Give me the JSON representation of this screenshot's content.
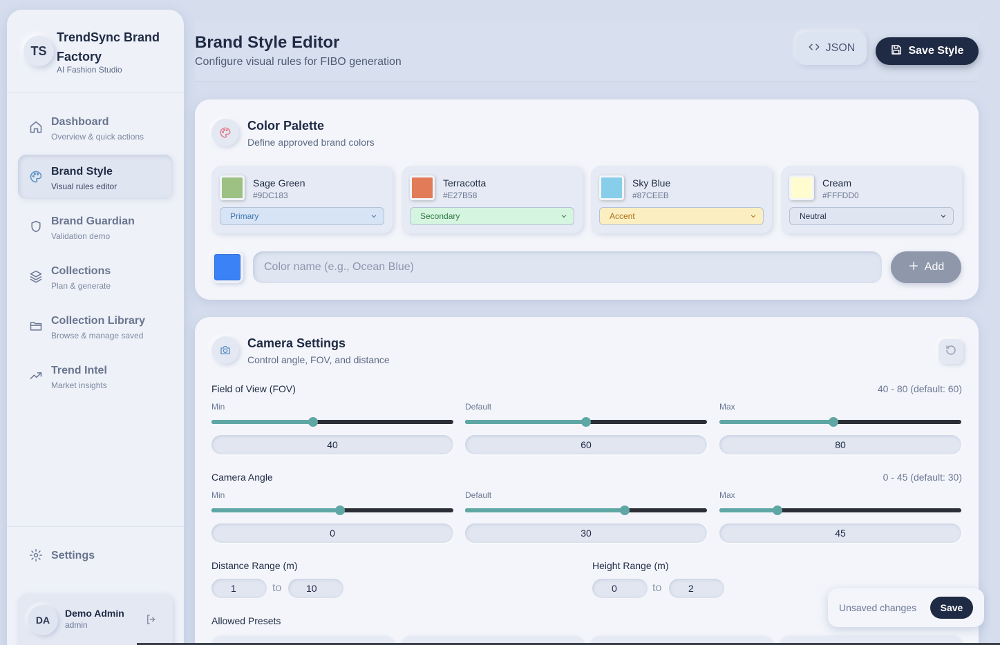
{
  "brand": {
    "initials": "TS",
    "title": "TrendSync Brand Factory",
    "subtitle": "AI Fashion Studio"
  },
  "nav": [
    {
      "label": "Dashboard",
      "sub": "Overview & quick actions",
      "icon": "home-icon",
      "active": false
    },
    {
      "label": "Brand Style",
      "sub": "Visual rules editor",
      "icon": "palette-icon",
      "active": true
    },
    {
      "label": "Brand Guardian",
      "sub": "Validation demo",
      "icon": "shield-icon",
      "active": false
    },
    {
      "label": "Collections",
      "sub": "Plan & generate",
      "icon": "layers-icon",
      "active": false
    },
    {
      "label": "Collection Library",
      "sub": "Browse & manage saved",
      "icon": "folder-icon",
      "active": false
    },
    {
      "label": "Trend Intel",
      "sub": "Market insights",
      "icon": "trending-icon",
      "active": false
    }
  ],
  "settings": {
    "label": "Settings",
    "icon": "gear-icon"
  },
  "user": {
    "initials": "DA",
    "name": "Demo Admin",
    "role": "admin"
  },
  "header": {
    "title": "Brand Style Editor",
    "subtitle": "Configure visual rules for FIBO generation",
    "json_label": "JSON",
    "save_label": "Save Style"
  },
  "palette": {
    "title": "Color Palette",
    "subtitle": "Define approved brand colors",
    "colors": [
      {
        "name": "Sage Green",
        "hex": "#9DC183",
        "role": "Primary",
        "role_bg": "#d6e4f5",
        "role_color": "#3f76b0"
      },
      {
        "name": "Terracotta",
        "hex": "#E27B58",
        "role": "Secondary",
        "role_bg": "#d6f5e0",
        "role_color": "#2f7a45"
      },
      {
        "name": "Sky Blue",
        "hex": "#87CEEB",
        "role": "Accent",
        "role_bg": "#fbefc2",
        "role_color": "#b0701a"
      },
      {
        "name": "Cream",
        "hex": "#FFFDD0",
        "role": "Neutral",
        "role_bg": "#dfe5f1",
        "role_color": "#2b3550"
      }
    ],
    "new_color": "#3B82F6",
    "input_placeholder": "Color name (e.g., Ocean Blue)",
    "add_label": "Add"
  },
  "camera": {
    "title": "Camera Settings",
    "subtitle": "Control angle, FOV, and distance",
    "fov": {
      "label": "Field of View (FOV)",
      "range_text": "40 - 80 (default: 60)",
      "min_label": "Min",
      "default_label": "Default",
      "max_label": "Max",
      "min": "40",
      "default": "60",
      "max": "80",
      "min_pos": 0.42,
      "default_pos": 0.5,
      "max_pos": 0.47
    },
    "angle": {
      "label": "Camera Angle",
      "range_text": "0 - 45 (default: 30)",
      "min_label": "Min",
      "default_label": "Default",
      "max_label": "Max",
      "min": "0",
      "default": "30",
      "max": "45",
      "min_pos": 0.53,
      "default_pos": 0.66,
      "max_pos": 0.24
    },
    "distance": {
      "label": "Distance Range (m)",
      "from": "1",
      "to_word": "to",
      "to": "10"
    },
    "height": {
      "label": "Height Range (m)",
      "from": "0",
      "to_word": "to",
      "to": "2"
    },
    "presets_label": "Allowed Presets"
  },
  "toast": {
    "text": "Unsaved changes",
    "save": "Save"
  }
}
